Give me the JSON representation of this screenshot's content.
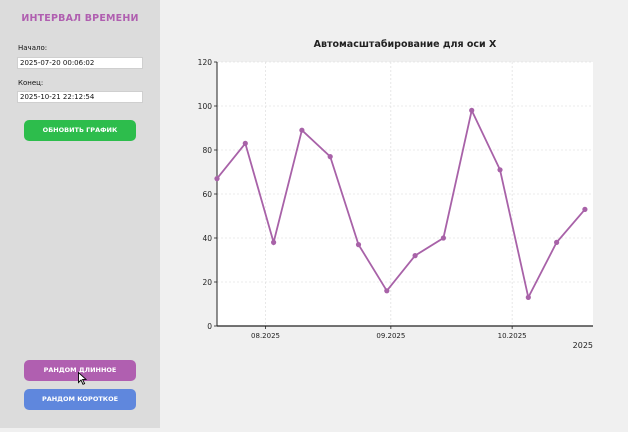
{
  "sidebar": {
    "title": "ИНТЕРВАЛ ВРЕМЕНИ",
    "start_label": "Начало:",
    "start_value": "2025-07-20 00:06:02",
    "end_label": "Конец:",
    "end_value": "2025-10-21 22:12:54",
    "update_button": "ОБНОВИТЬ ГРАФИК",
    "random_long_button": "РАНДОМ ДЛИННОЕ",
    "random_short_button": "РАНДОМ КОРОТКОЕ"
  },
  "colors": {
    "line": "#a862a8",
    "update_button": "#2dbd4c",
    "random_long_button": "#b05fb0",
    "random_short_button": "#5f87dd",
    "title": "#b05fb0"
  },
  "chart_data": {
    "type": "line",
    "title": "Автомасштабирование для оси X",
    "x": [
      "2025-07-20",
      "2025-07-27",
      "2025-08-03",
      "2025-08-10",
      "2025-08-17",
      "2025-08-24",
      "2025-08-31",
      "2025-09-07",
      "2025-09-14",
      "2025-09-21",
      "2025-09-28",
      "2025-10-05",
      "2025-10-12",
      "2025-10-19"
    ],
    "values": [
      67,
      83,
      38,
      89,
      77,
      37,
      16,
      32,
      40,
      98,
      71,
      13,
      38,
      53
    ],
    "xlim": [
      "2025-07-20",
      "2025-10-21"
    ],
    "ylim": [
      0,
      120
    ],
    "yticks": [
      0,
      20,
      40,
      60,
      80,
      100,
      120
    ],
    "xticks": [
      {
        "date": "2025-08-01",
        "label": "08.2025"
      },
      {
        "date": "2025-09-01",
        "label": "09.2025"
      },
      {
        "date": "2025-10-01",
        "label": "10.2025"
      }
    ],
    "x_offset_label": "2025",
    "grid": true
  }
}
